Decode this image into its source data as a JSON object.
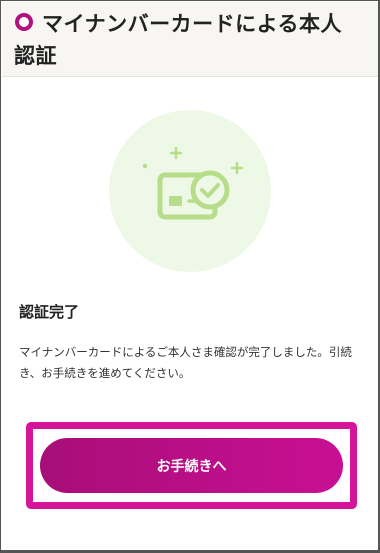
{
  "header": {
    "title_line1": "マイナンバーカードによる本人",
    "title_line2": "認証",
    "ring_icon": "circle-ring-icon",
    "accent": "#b1127f"
  },
  "illustration": {
    "icon": "card-check-icon",
    "color": "#b7dc8a",
    "bg": "#eef8e6"
  },
  "status": {
    "title": "認証完了",
    "message": "マイナンバーカードによるご本人さま確認が完了しました。引続き、お手続きを進めてください。"
  },
  "cta": {
    "label": "お手続きへ",
    "color": "#c10f8c",
    "highlight_color": "#d4149a"
  }
}
